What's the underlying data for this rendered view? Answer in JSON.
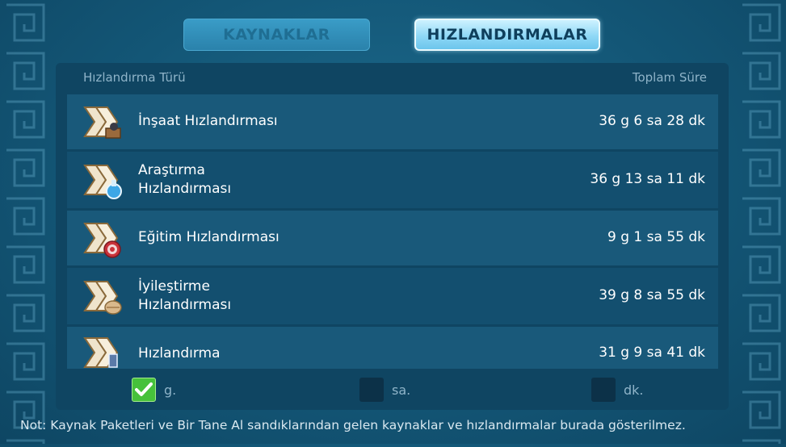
{
  "tabs": {
    "resources": "KAYNAKLAR",
    "speedups": "HIZLANDIRMALAR"
  },
  "table": {
    "col_type": "Hızlandırma Türü",
    "col_total": "Toplam Süre",
    "rows": [
      {
        "name_line1": "İnşaat Hızlandırması",
        "name_line2": "",
        "total": "36 g 6 sa 28 dk",
        "icon": "construction-speedup-icon"
      },
      {
        "name_line1": "Araştırma",
        "name_line2": "Hızlandırması",
        "total": "36 g 13 sa 11 dk",
        "icon": "research-speedup-icon"
      },
      {
        "name_line1": "Eğitim Hızlandırması",
        "name_line2": "",
        "total": "9 g 1 sa 55 dk",
        "icon": "training-speedup-icon"
      },
      {
        "name_line1": "İyileştirme",
        "name_line2": "Hızlandırması",
        "total": "39 g 8 sa 55 dk",
        "icon": "healing-speedup-icon"
      },
      {
        "name_line1": "Hızlandırma",
        "name_line2": "",
        "total": "31 g 9 sa 41 dk",
        "icon": "universal-speedup-icon"
      }
    ]
  },
  "units": {
    "days": {
      "label": "g.",
      "checked": true
    },
    "hours": {
      "label": "sa.",
      "checked": false
    },
    "minutes": {
      "label": "dk.",
      "checked": false
    }
  },
  "note": "Not: Kaynak Paketleri ve Bir Tane Al sandıklarından gelen kaynaklar ve hızlandırmalar burada gösterilmez.",
  "colors": {
    "background": "#135676",
    "panel": "#0f4562",
    "active_tab": "#8fd8f6",
    "checkbox_checked": "#46c13b"
  }
}
